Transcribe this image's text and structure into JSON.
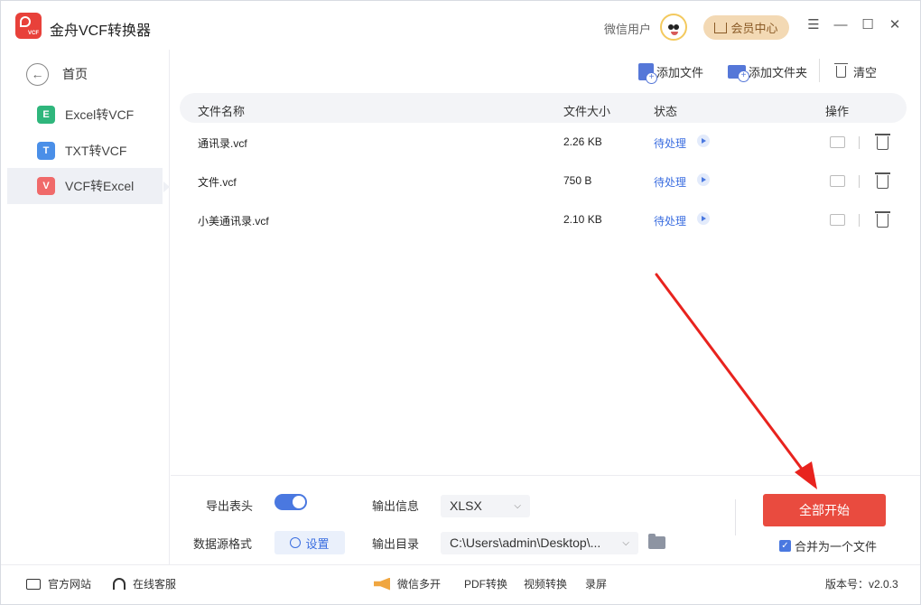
{
  "app": {
    "title": "金舟VCF转换器",
    "logo_text": "VCF"
  },
  "user": {
    "name": "微信用户",
    "vip_label": "会员中心"
  },
  "sidebar": {
    "home_label": "首页",
    "items": [
      {
        "badge": "E",
        "label": "Excel转VCF",
        "color": "#2fb67c"
      },
      {
        "badge": "T",
        "label": "TXT转VCF",
        "color": "#4a8fe8"
      },
      {
        "badge": "V",
        "label": "VCF转Excel",
        "color": "#f06a6a"
      }
    ]
  },
  "toolbar": {
    "add_file": "添加文件",
    "add_folder": "添加文件夹",
    "clear": "清空"
  },
  "table": {
    "headers": {
      "name": "文件名称",
      "size": "文件大小",
      "status": "状态",
      "action": "操作"
    },
    "rows": [
      {
        "name": "通讯录.vcf",
        "size": "2.26 KB",
        "status": "待处理"
      },
      {
        "name": "文件.vcf",
        "size": "750 B",
        "status": "待处理"
      },
      {
        "name": "小美通讯录.vcf",
        "size": "2.10 KB",
        "status": "待处理"
      }
    ]
  },
  "settings": {
    "export_header_label": "导出表头",
    "export_header_on": true,
    "source_format_label": "数据源格式",
    "setup_label": "设置",
    "output_info_label": "输出信息",
    "output_format": "XLSX",
    "output_dir_label": "输出目录",
    "output_dir": "C:\\Users\\admin\\Desktop\\...",
    "start_label": "全部开始",
    "merge_label": "合并为一个文件",
    "merge_checked": true
  },
  "statusbar": {
    "website": "官方网站",
    "support": "在线客服",
    "wechat_multi": "微信多开",
    "pdf": "PDF转换",
    "video": "视频转换",
    "record": "录屏",
    "version": "版本号：v2.0.3"
  },
  "colors": {
    "accent": "#4a78e0",
    "start": "#e94b3f",
    "annotation": "#e8231e"
  }
}
